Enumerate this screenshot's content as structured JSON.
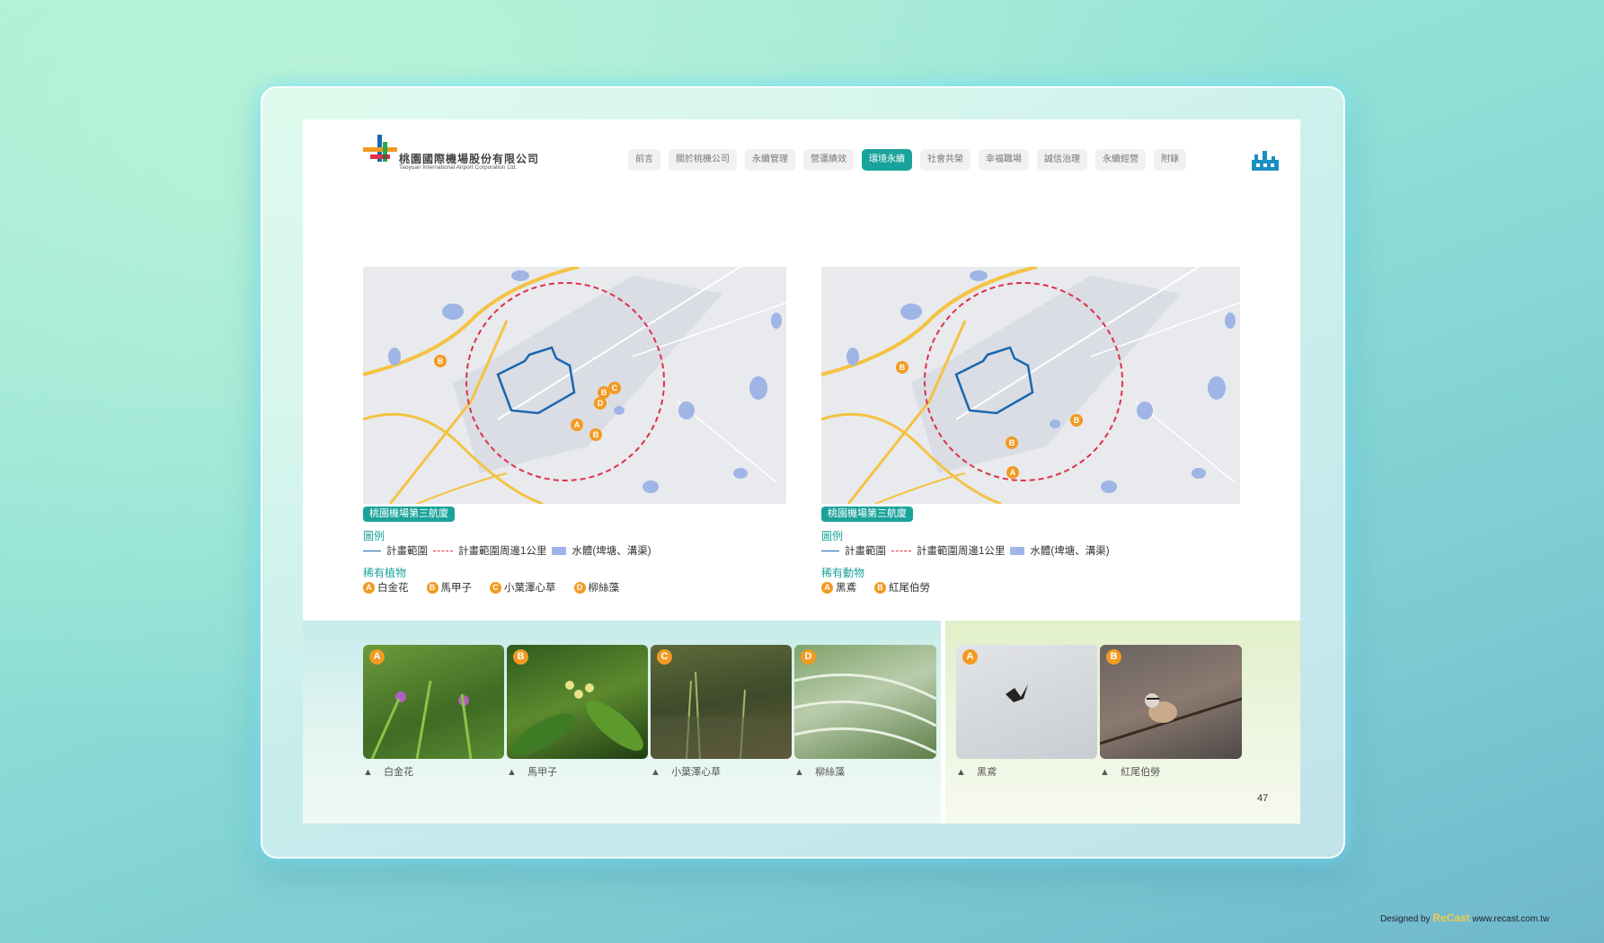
{
  "header": {
    "logo_zh": "桃園國際機場股份有限公司",
    "logo_en": "Taoyuan International Airport Corporation Ltd."
  },
  "nav": [
    "前言",
    "關於桃機公司",
    "永續管理",
    "營運績效",
    "環境永續",
    "社會共榮",
    "幸福職場",
    "誠信治理",
    "永續經營",
    "附錄"
  ],
  "nav_active": "環境永續",
  "maps": [
    {
      "label": "桃園機場第三航廈",
      "legend_title": "圖例",
      "legend": [
        "計畫範圍",
        "計畫範圍周邊1公里",
        "水體(埤塘、溝渠)"
      ],
      "species_title": "稀有植物",
      "species": [
        {
          "badge": "A",
          "name": "白金花"
        },
        {
          "badge": "B",
          "name": "馬甲子"
        },
        {
          "badge": "C",
          "name": "小葉澤心草"
        },
        {
          "badge": "D",
          "name": "柳絲藻"
        }
      ]
    },
    {
      "label": "桃園機場第三航廈",
      "legend_title": "圖例",
      "legend": [
        "計畫範圍",
        "計畫範圍周邊1公里",
        "水體(埤塘、溝渠)"
      ],
      "species_title": "稀有動物",
      "species": [
        {
          "badge": "A",
          "name": "黑鳶"
        },
        {
          "badge": "B",
          "name": "紅尾伯勞"
        }
      ]
    }
  ],
  "photos": [
    {
      "badge": "A",
      "caption": "白金花"
    },
    {
      "badge": "B",
      "caption": "馬甲子"
    },
    {
      "badge": "C",
      "caption": "小葉澤心草"
    },
    {
      "badge": "D",
      "caption": "柳絲藻"
    },
    {
      "badge": "A",
      "caption": "黑鳶"
    },
    {
      "badge": "B",
      "caption": "紅尾伯勞"
    }
  ],
  "caption_marker": "▲",
  "page_number": "47",
  "credit": {
    "prefix": "Designed by",
    "brand": "ReCast",
    "url": "www.recast.com.tw"
  },
  "colors": {
    "accent": "#1aa39a",
    "badge": "#f29a21",
    "boundary": "#1b67b2",
    "buffer": "#e0304a",
    "water": "#9fb5e6"
  }
}
